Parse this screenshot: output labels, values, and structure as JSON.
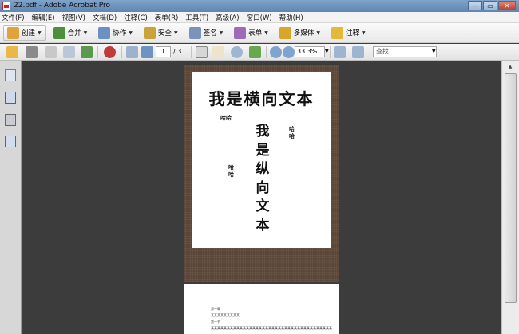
{
  "window": {
    "title": "22.pdf - Adobe Acrobat Pro",
    "buttons": [
      "—",
      "▭",
      "✕"
    ]
  },
  "menu": [
    "文件(F)",
    "编辑(E)",
    "视图(V)",
    "文档(D)",
    "注释(C)",
    "表单(R)",
    "工具(T)",
    "高级(A)",
    "窗口(W)",
    "帮助(H)"
  ],
  "tasks": [
    {
      "label": "创建",
      "icon": "create-icon",
      "color": "#e0a23a"
    },
    {
      "label": "合并",
      "icon": "combine-icon",
      "color": "#4d8f3a"
    },
    {
      "label": "协作",
      "icon": "collaborate-icon",
      "color": "#6c8fc4"
    },
    {
      "label": "安全",
      "icon": "lock-icon",
      "color": "#c9a23a"
    },
    {
      "label": "签名",
      "icon": "pen-icon",
      "color": "#7b93b8"
    },
    {
      "label": "表单",
      "icon": "form-icon",
      "color": "#9d6bb8"
    },
    {
      "label": "多媒体",
      "icon": "multimedia-icon",
      "color": "#d9a52b"
    },
    {
      "label": "注释",
      "icon": "comment-icon",
      "color": "#e2b93b"
    }
  ],
  "nav": {
    "page_current": "1",
    "page_total": "/ 3",
    "zoom": "33.3%",
    "search_placeholder": "查找"
  },
  "document": {
    "page1_horizontal": "我是横向文本",
    "page1_vertical": [
      "我",
      "是",
      "纵",
      "向",
      "文",
      "本"
    ],
    "page1_small_left_top": "哈哈",
    "page1_small_right_top": [
      "哈",
      "哈"
    ],
    "page1_small_left_mid": [
      "哈",
      "哈"
    ],
    "page2_line1": "第一章",
    "page2_line2": "某某某某某某某某某",
    "page2_line3": "第一节",
    "page2_line4": "某某某某某某某某某某某某某某某某某某某某某某某某某某某某某某某某某某某某某某"
  }
}
